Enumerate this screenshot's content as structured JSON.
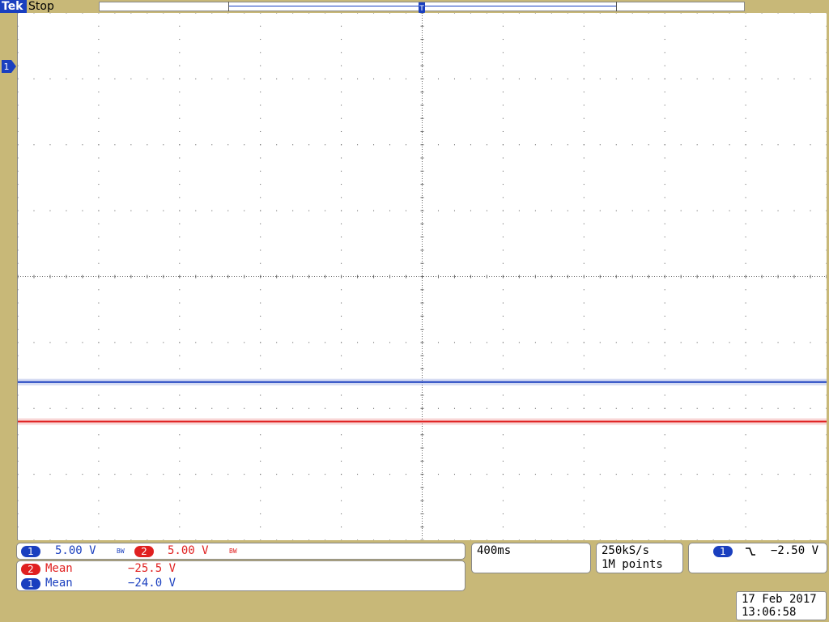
{
  "status_bar": {
    "brand": "Tek",
    "run_state": "Stop"
  },
  "markers": {
    "channel_marker": "1",
    "trigger_position_marker": "T"
  },
  "channels": [
    {
      "badge": "1",
      "scale": "5.00 V",
      "bw_icon": "BW",
      "color": "#1a3fbf"
    },
    {
      "badge": "2",
      "scale": "5.00 V",
      "bw_icon": "BW",
      "color": "#e02020"
    }
  ],
  "measurements": [
    {
      "badge": "2",
      "label": "Mean",
      "value": "−25.5 V",
      "color": "#e02020"
    },
    {
      "badge": "1",
      "label": "Mean",
      "value": "−24.0 V",
      "color": "#1a3fbf"
    }
  ],
  "timebase": {
    "value": "400ms"
  },
  "acquisition": {
    "sample_rate": "250kS/s",
    "record_length": "1M points"
  },
  "trigger": {
    "source": "1",
    "slope_icon": "falling-edge-icon",
    "level": "−2.50 V"
  },
  "datetime": {
    "date": "17 Feb  2017",
    "time": "13:06:58"
  },
  "chart_data": {
    "type": "line",
    "x_divisions": 10,
    "y_divisions": 8,
    "x_per_div": "400ms",
    "y_per_div": "5.00 V",
    "grid": true,
    "series": [
      {
        "channel": "1",
        "color": "#1a3fbf",
        "level_div": -1.6,
        "mean": "−24.0 V"
      },
      {
        "channel": "2",
        "color": "#e02020",
        "level_div": -2.2,
        "mean": "−25.5 V"
      }
    ]
  }
}
